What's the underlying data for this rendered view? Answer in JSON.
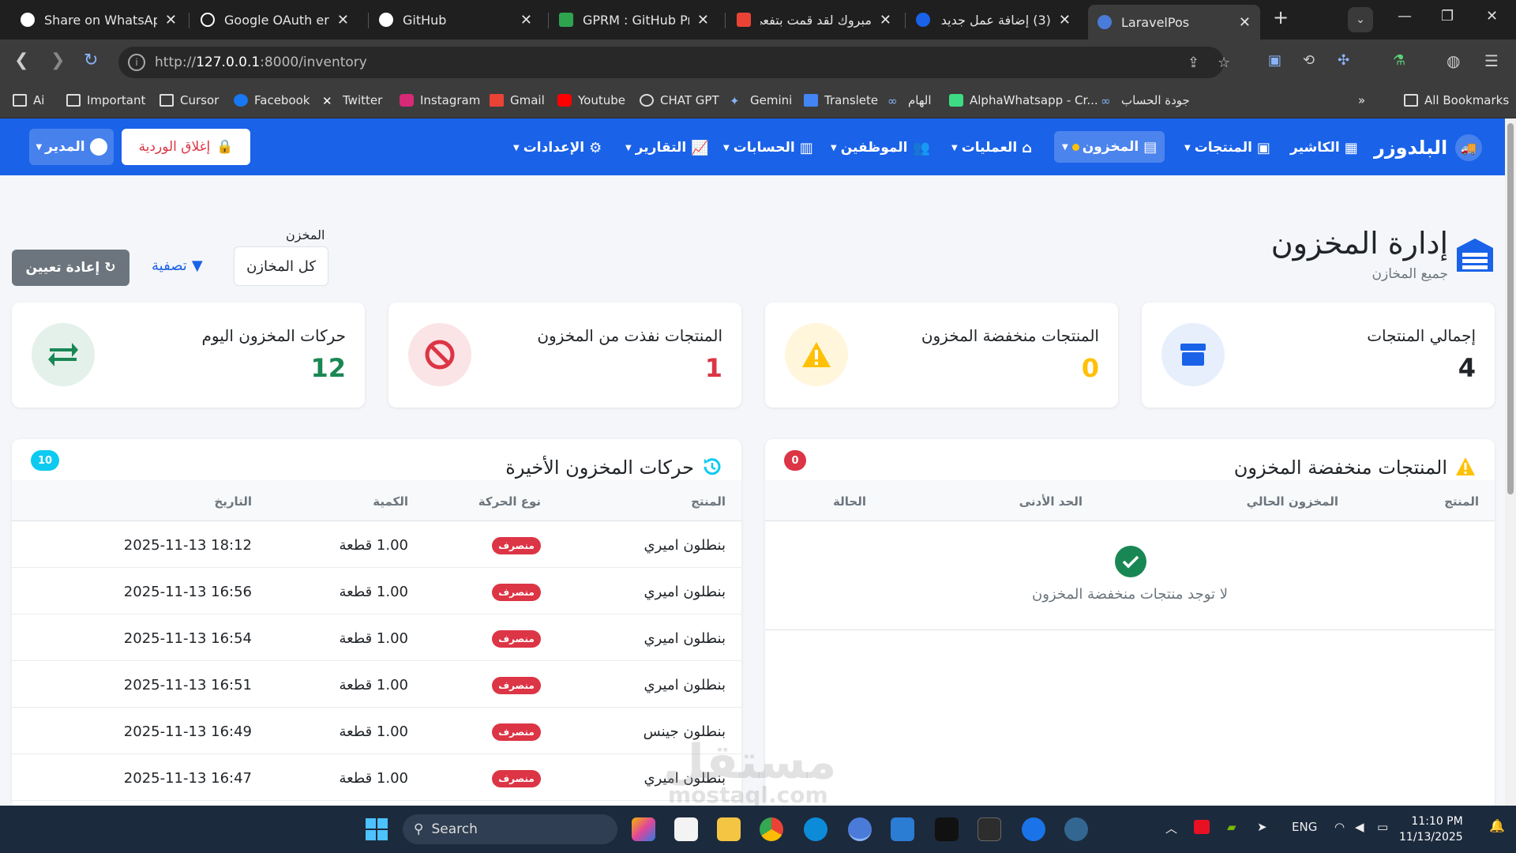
{
  "browser": {
    "tabs": [
      {
        "title": "Share on WhatsApp",
        "color": "#ffffff"
      },
      {
        "title": "Google OAuth error",
        "color": "#ffffff"
      },
      {
        "title": "GitHub",
        "color": "#ffffff"
      },
      {
        "title": "GPRM : GitHub Profi",
        "color": "#2ea44f"
      },
      {
        "title": "مبروك لقد قمت بتفعي",
        "color": "#ea4335"
      },
      {
        "title": "(3) إضافة عمل جديد |",
        "color": "#1a62e8"
      },
      {
        "title": "LaravelPos",
        "color": "#4a7bd8"
      }
    ],
    "url_prefix": "http://",
    "url_host": "127.0.0.1",
    "url_rest": ":8000/inventory",
    "bookmarks": [
      "Ai",
      "Important",
      "Cursor",
      "Facebook",
      "Twitter",
      "Instagram",
      "Gmail",
      "Youtube",
      "CHAT GPT",
      "Gemini",
      "Translete",
      "الهام",
      "AlphaWhatsapp - Cr...",
      "جودة الحساب"
    ],
    "all_bookmarks": "All Bookmarks"
  },
  "navbar": {
    "brand": "البلدوزر",
    "items": [
      "الكاشير",
      "المنتجات",
      "المخزون",
      "العمليات",
      "الموظفين",
      "الحسابات",
      "التقارير",
      "الإعدادات"
    ],
    "close_shift": "إغلاق الوردية",
    "manager": "المدير"
  },
  "page": {
    "title": "إدارة المخزون",
    "subtitle": "جميع المخازن",
    "filter_label": "المخزن",
    "filter_value": "كل المخازن",
    "filter_button": "تصفية",
    "reset_button": "إعادة تعيين"
  },
  "stats": [
    {
      "label": "إجمالي المنتجات",
      "value": "4",
      "color": "#212529",
      "bg": "#e7effd",
      "icon": "box-icon"
    },
    {
      "label": "المنتجات منخفضة المخزون",
      "value": "0",
      "color": "#ffc107",
      "bg": "#fff6dc",
      "icon": "warning-icon"
    },
    {
      "label": "المنتجات نفذت من المخزون",
      "value": "1",
      "color": "#dc3545",
      "bg": "#fbe4e6",
      "icon": "ban-icon"
    },
    {
      "label": "حركات المخزون اليوم",
      "value": "12",
      "color": "#198754",
      "bg": "#e3f1ea",
      "icon": "exchange-icon"
    }
  ],
  "low_stock": {
    "title": "المنتجات منخفضة المخزون",
    "badge": "0",
    "headers": [
      "المنتج",
      "المخزون الحالي",
      "الحد الأدنى",
      "الحالة"
    ],
    "empty": "لا توجد منتجات منخفضة المخزون"
  },
  "movements": {
    "title": "حركات المخزون الأخيرة",
    "badge": "10",
    "headers": [
      "المنتج",
      "نوع الحركة",
      "الكمية",
      "التاريخ"
    ],
    "rows": [
      {
        "product": "بنطلون اميري",
        "type": "منصرف",
        "qty": "1.00 قطعة",
        "date": "2025-11-13 18:12"
      },
      {
        "product": "بنطلون اميري",
        "type": "منصرف",
        "qty": "1.00 قطعة",
        "date": "2025-11-13 16:56"
      },
      {
        "product": "بنطلون اميري",
        "type": "منصرف",
        "qty": "1.00 قطعة",
        "date": "2025-11-13 16:54"
      },
      {
        "product": "بنطلون اميري",
        "type": "منصرف",
        "qty": "1.00 قطعة",
        "date": "2025-11-13 16:51"
      },
      {
        "product": "بنطلون جينس",
        "type": "منصرف",
        "qty": "1.00 قطعة",
        "date": "2025-11-13 16:49"
      },
      {
        "product": "بنطلون اميري",
        "type": "منصرف",
        "qty": "1.00 قطعة",
        "date": "2025-11-13 16:47"
      }
    ]
  },
  "watermark": {
    "main": "مستقل",
    "sub": "mostaql.com"
  },
  "taskbar": {
    "search": "Search",
    "lang": "ENG",
    "time": "11:10 PM",
    "date": "11/13/2025"
  }
}
